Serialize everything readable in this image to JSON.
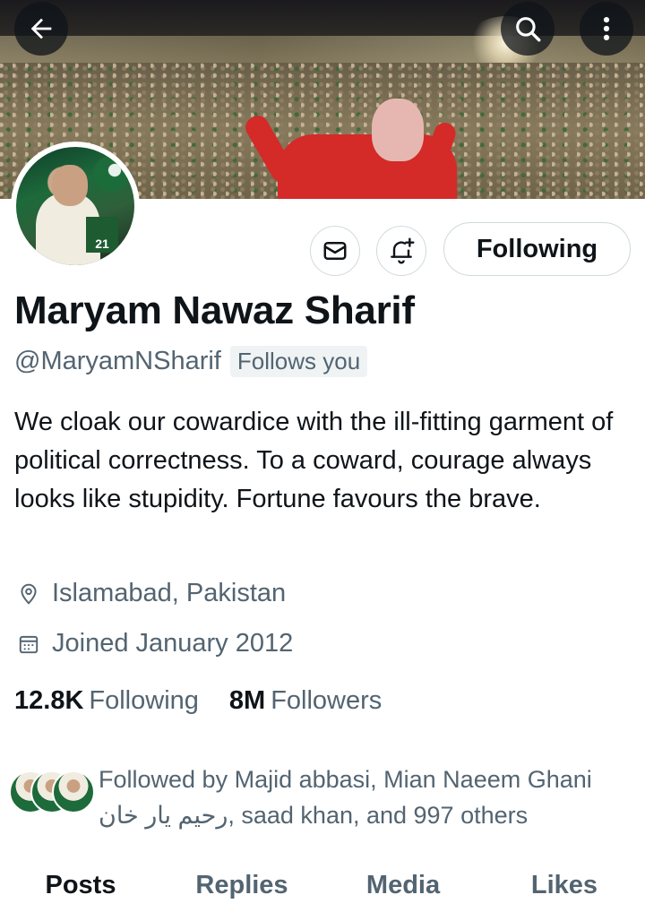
{
  "profile": {
    "name": "Maryam Nawaz Sharif",
    "handle": "@MaryamNSharif",
    "follows_you": "Follows you",
    "bio": "We cloak our cowardice with the ill-fitting garment of political correctness. To a coward, courage always looks like stupidity. Fortune favours the brave.",
    "location": "Islamabad, Pakistan",
    "joined": "Joined January 2012",
    "avatar_badge": "21"
  },
  "actions": {
    "following_label": "Following"
  },
  "stats": {
    "following_count": "12.8K",
    "following_label": "Following",
    "followers_count": "8M",
    "followers_label": "Followers"
  },
  "followed_by": {
    "text": "Followed by Majid abbasi, Mian Naeem Ghani رحیم یار خان, saad khan, and 997 others"
  },
  "tabs": [
    {
      "label": "Posts",
      "active": true
    },
    {
      "label": "Replies",
      "active": false
    },
    {
      "label": "Media",
      "active": false
    },
    {
      "label": "Likes",
      "active": false
    }
  ],
  "icons": {
    "back": "arrow-left-icon",
    "search": "search-icon",
    "more": "more-vertical-icon",
    "mail": "mail-icon",
    "notify": "bell-plus-icon",
    "location": "location-pin-icon",
    "calendar": "calendar-icon"
  },
  "colors": {
    "text_primary": "#0f1419",
    "text_secondary": "#536471",
    "border": "#cfd9de"
  }
}
